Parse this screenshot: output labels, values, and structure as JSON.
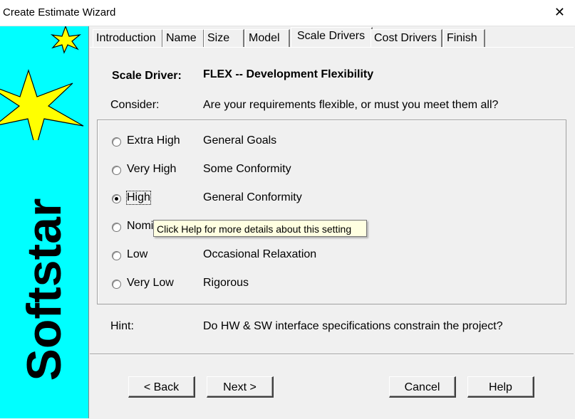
{
  "window": {
    "title": "Create Estimate Wizard",
    "close_glyph": "✕"
  },
  "sidebar": {
    "brand_text": "Softstar",
    "background": "#00ffff",
    "star_color": "#ffff00"
  },
  "tabs": [
    "Introduction",
    "Name",
    "Size",
    "Model",
    "Scale Drivers",
    "Cost Drivers",
    "Finish"
  ],
  "active_tab": "Scale Drivers",
  "driver": {
    "label": "Scale Driver:",
    "name": "FLEX -- Development Flexibility",
    "consider_label": "Consider:",
    "consider_text": "Are your requirements flexible, or must you meet them all?"
  },
  "options": [
    {
      "label": "Extra High",
      "description": "General Goals",
      "selected": false
    },
    {
      "label": "Very High",
      "description": "Some Conformity",
      "selected": false
    },
    {
      "label": "High",
      "description": "General Conformity",
      "selected": true
    },
    {
      "label": "Nomi",
      "description": "",
      "selected": false
    },
    {
      "label": "Low",
      "description": "Occasional Relaxation",
      "selected": false
    },
    {
      "label": "Very Low",
      "description": "Rigorous",
      "selected": false
    }
  ],
  "tooltip": "Click Help for more details about this setting",
  "hint": {
    "label": "Hint:",
    "text": "Do HW & SW interface specifications constrain the project?"
  },
  "buttons": {
    "back": "< Back",
    "next": "Next >",
    "cancel": "Cancel",
    "help": "Help"
  }
}
